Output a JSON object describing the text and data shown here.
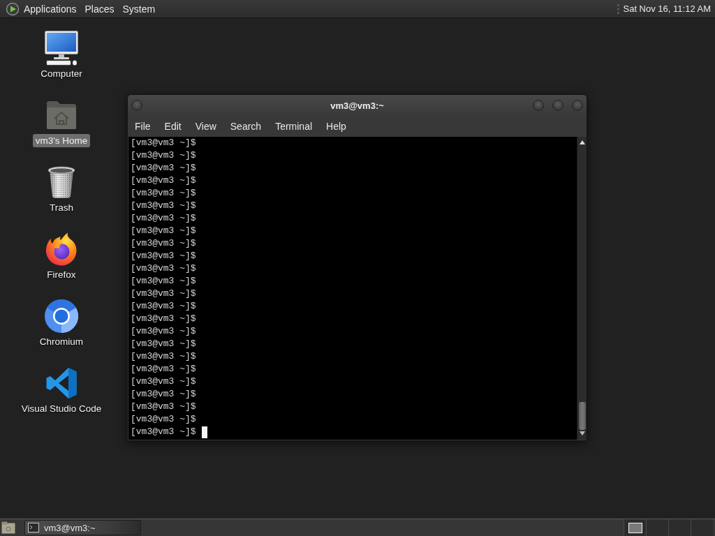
{
  "top_panel": {
    "menus": [
      "Applications",
      "Places",
      "System"
    ],
    "clock": "Sat Nov 16, 11:12 AM"
  },
  "desktop_icons": [
    {
      "kind": "computer",
      "label": "Computer",
      "selected": false
    },
    {
      "kind": "home",
      "label": "vm3's Home",
      "selected": true
    },
    {
      "kind": "trash",
      "label": "Trash",
      "selected": false
    },
    {
      "kind": "firefox",
      "label": "Firefox",
      "selected": false
    },
    {
      "kind": "chromium",
      "label": "Chromium",
      "selected": false
    },
    {
      "kind": "vscode",
      "label": "Visual Studio Code",
      "selected": false
    }
  ],
  "terminal_window": {
    "title": "vm3@vm3:~",
    "menu": [
      "File",
      "Edit",
      "View",
      "Search",
      "Terminal",
      "Help"
    ],
    "lines": [
      "[vm3@vm3 ~]$",
      "[vm3@vm3 ~]$",
      "[vm3@vm3 ~]$",
      "[vm3@vm3 ~]$",
      "[vm3@vm3 ~]$",
      "[vm3@vm3 ~]$",
      "[vm3@vm3 ~]$",
      "[vm3@vm3 ~]$",
      "[vm3@vm3 ~]$",
      "[vm3@vm3 ~]$",
      "[vm3@vm3 ~]$",
      "[vm3@vm3 ~]$",
      "[vm3@vm3 ~]$",
      "[vm3@vm3 ~]$",
      "[vm3@vm3 ~]$",
      "[vm3@vm3 ~]$",
      "[vm3@vm3 ~]$",
      "[vm3@vm3 ~]$",
      "[vm3@vm3 ~]$",
      "[vm3@vm3 ~]$",
      "[vm3@vm3 ~]$",
      "[vm3@vm3 ~]$",
      "[vm3@vm3 ~]$",
      "[vm3@vm3 ~]$"
    ],
    "cursor": true
  },
  "bottom_panel": {
    "tasks": [
      {
        "label": "vm3@vm3:~"
      }
    ],
    "workspaces": [
      {
        "selected": true
      },
      {
        "selected": false
      },
      {
        "selected": false
      },
      {
        "selected": false
      }
    ]
  }
}
